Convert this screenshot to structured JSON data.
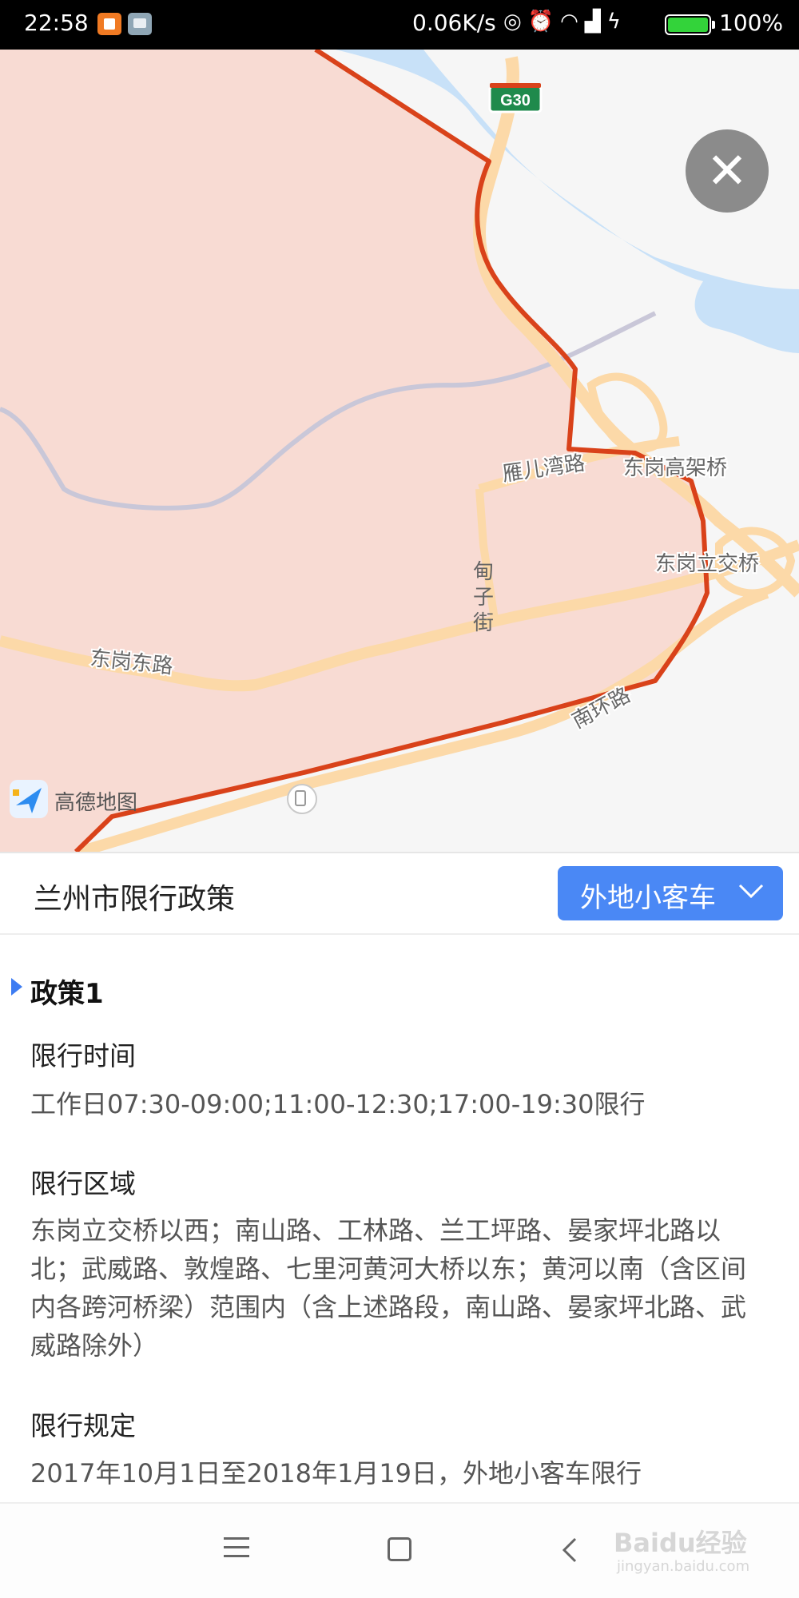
{
  "status_bar": {
    "time": "22:58",
    "net_speed": "0.06K/s",
    "battery_percent": "100%",
    "battery_level": 1.0,
    "icons": [
      "notification-app-icon",
      "notification-app2-icon",
      "hotspot-icon",
      "alarm-icon",
      "wifi-icon",
      "signal-icon",
      "charging-icon",
      "battery-icon"
    ]
  },
  "map": {
    "highway_badge": "G30",
    "labels": {
      "yanerwan_road": "雁儿湾路",
      "donggang_viaduct": "东岗高架桥",
      "dianzi_street": "甸子街",
      "donggang_interchange": "东岗立交桥",
      "donggang_east_road": "东岗东路",
      "nanhuan_road": "南环路"
    },
    "logo_text": "高德地图",
    "colors": {
      "restricted_zone": "#f8dbd3",
      "boundary": "#d9421a",
      "river": "#c8e1f8",
      "road": "#fcd9a8"
    }
  },
  "close_button": {
    "icon": "close-icon"
  },
  "header": {
    "title": "兰州市限行政策",
    "vehicle_select": "外地小客车"
  },
  "policy": {
    "title": "政策1",
    "time_label": "限行时间",
    "time_text": "工作日07:30-09:00;11:00-12:30;17:00-19:30限行",
    "area_label": "限行区域",
    "area_text": "东岗立交桥以西；南山路、工林路、兰工坪路、晏家坪北路以北；武威路、敦煌路、七里河黄河大桥以东；黄河以南（含区间内各跨河桥梁）范围内（含上述路段，南山路、晏家坪北路、武威路除外）",
    "rule_label": "限行规定",
    "rule_text": "2017年10月1日至2018年1月19日，外地小客车限行"
  },
  "nav_bar": {
    "watermark": "Baidu经验",
    "watermark_sub": "jingyan.baidu.com"
  }
}
